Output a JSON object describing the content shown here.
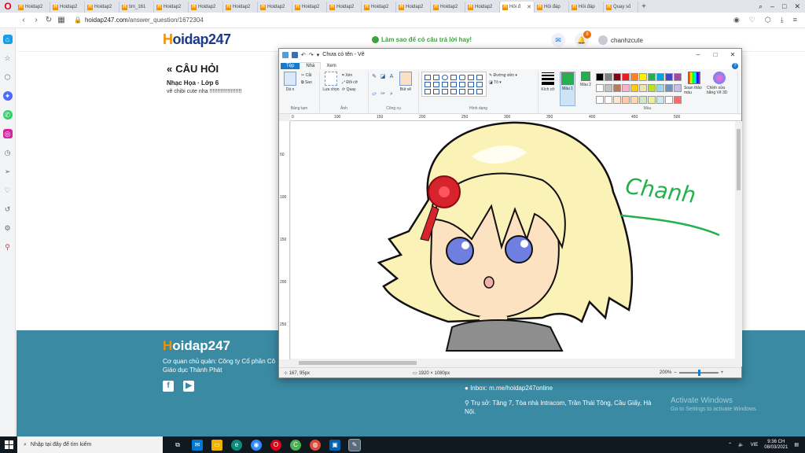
{
  "browser": {
    "tabs": [
      {
        "label": "Hoidap2"
      },
      {
        "label": "Hoidap2"
      },
      {
        "label": "Hoidap2"
      },
      {
        "label": "tim_161"
      },
      {
        "label": "Hoidap2"
      },
      {
        "label": "Hoidap2"
      },
      {
        "label": "Hoidap2"
      },
      {
        "label": "Hoidap2"
      },
      {
        "label": "Hoidap2"
      },
      {
        "label": "Hoidap2"
      },
      {
        "label": "Hoidap2"
      },
      {
        "label": "Hoidap2"
      },
      {
        "label": "Hoidap2"
      },
      {
        "label": "Hoidap2"
      },
      {
        "label": "Hỏi đ",
        "active": true
      },
      {
        "label": "Hỏi đáp"
      },
      {
        "label": "Hỏi đáp"
      },
      {
        "label": "Quay số"
      }
    ],
    "url_host": "hoidap247.com",
    "url_path": "/answer_question/1672304"
  },
  "site": {
    "logo_first": "H",
    "logo_rest": "oidap247",
    "promo": "Làm sao để có câu trả lời hay!",
    "notification_count": "8",
    "username": "chanhzcute"
  },
  "question": {
    "heading": "CÂU HỎI",
    "meta": "Nhạc Họa · Lớp 6",
    "body": "vẽ chibi cute nha !!!!!!!!!!!!!!!!!!!!!"
  },
  "footer": {
    "company": "Cơ quan chủ quản: Công ty Cổ phần Cô Giáo dục Thành Phát",
    "inbox": "Inbox: m.me/hoidap247online",
    "address": "Trụ sở: Tầng 7, Tòa nhà Intracom, Trần Thái Tông, Cầu Giấy, Hà Nội.",
    "activate_title": "Activate Windows",
    "activate_sub": "Go to Settings to activate Windows."
  },
  "paint": {
    "title": "Chưa có tên - Vẽ",
    "tabs": {
      "file": "Tệp",
      "home": "Nhà",
      "view": "Xem"
    },
    "groups": {
      "clipboard": "Bảng tạm",
      "image": "Ảnh",
      "tools": "Công cụ",
      "shapes": "Hình dạng",
      "colors": "Màu"
    },
    "buttons": {
      "paste": "Dá n",
      "cut": "Cắt",
      "copy": "Sao",
      "select": "Lựa chọn",
      "crop": "Xén",
      "resize": "Đổi cỡ",
      "rotate": "Quay",
      "brushes": "Bút vẽ",
      "outline": "Đường viền",
      "fill": "Tô",
      "size": "Kích cỡ",
      "color1": "Màu 1",
      "color2": "Màu 2",
      "edit_colors": "Soạn thảo màu",
      "paint3d": "Chỉnh sửa bằng Vẽ 3D"
    },
    "ruler_labels": [
      "0",
      "100",
      "150",
      "200",
      "250",
      "300",
      "350",
      "400",
      "450",
      "500"
    ],
    "vruler_labels": [
      "50",
      "100",
      "150",
      "200",
      "250"
    ],
    "status": {
      "position": "167, 95px",
      "size": "1920 × 1080px",
      "zoom": "200%"
    },
    "canvas_text": "Chanh",
    "colors": {
      "color1": "#22b14c",
      "color2": "#22b14c",
      "palette": [
        "#000000",
        "#7f7f7f",
        "#880015",
        "#ed1c24",
        "#ff7f27",
        "#fff200",
        "#22b14c",
        "#00a2e8",
        "#3f48cc",
        "#a349a4",
        "#ffffff",
        "#c3c3c3",
        "#b97a57",
        "#ffaec9",
        "#ffc90e",
        "#efe4b0",
        "#b5e61d",
        "#99d9ea",
        "#7092be",
        "#c8bfe7",
        "#ffffff",
        "#ffffff",
        "#ffe6cc",
        "#ffc8a8",
        "#ffd8b0",
        "#d0e8c8",
        "#e8f0a0",
        "#cce8f0",
        "#ffffff",
        "#ff6a6a"
      ]
    }
  },
  "taskbar": {
    "search_placeholder": "Nhập tại đây để tìm kiếm",
    "time": "9:36 CH",
    "date": "08/03/2021",
    "lang": "VIE"
  }
}
